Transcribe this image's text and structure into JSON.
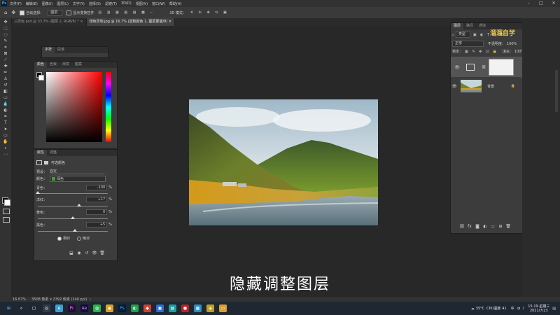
{
  "menubar": {
    "app_logo": "Ps",
    "items": [
      "文件(F)",
      "编辑(E)",
      "图像(I)",
      "图层(L)",
      "文字(Y)",
      "选择(S)",
      "滤镜(T)",
      "3D(D)",
      "视图(V)",
      "窗口(W)",
      "帮助(H)"
    ]
  },
  "options": {
    "auto_select_label": "自动选择：",
    "auto_select_value": "图层",
    "show_transform_label": "显示变换控件",
    "mode_3d_label": "3D 模式："
  },
  "tabs": [
    {
      "label": "三原色.psd @ 33.3% (图层 2, RGB/8) *",
      "close": "×"
    },
    {
      "label": "绿色草地.jpg @ 16.7% (选取颜色 1, 图层蒙版/8)",
      "close": "×"
    }
  ],
  "char_panel": {
    "tabs": [
      "字符",
      "段落"
    ]
  },
  "color_panel": {
    "tabs": [
      "颜色",
      "色板",
      "渐变",
      "图案"
    ]
  },
  "properties": {
    "tabs": [
      "属性",
      "调整"
    ],
    "title": "可选颜色",
    "preset_label": "预设：",
    "preset_value": "自定",
    "colors_label": "颜色：",
    "colors_value": "绿色",
    "rows": [
      {
        "label": "青色：",
        "value": "-100",
        "unit": "%",
        "slider": 0.0
      },
      {
        "label": "洋红：",
        "value": "+17",
        "unit": "%",
        "slider": 0.585
      },
      {
        "label": "黄色：",
        "value": "0",
        "unit": "%",
        "slider": 0.5
      },
      {
        "label": "黑色：",
        "value": "+5",
        "unit": "%",
        "slider": 0.525
      }
    ],
    "method_relative": "相对",
    "method_absolute": "绝对"
  },
  "layers_panel": {
    "tabs": [
      "图层",
      "路径",
      "通道"
    ],
    "kind_label": "类型",
    "blend_mode": "正常",
    "opacity_label": "不透明度：",
    "opacity_value": "100%",
    "lock_label": "锁定：",
    "fill_label": "填充：",
    "fill_value": "100%",
    "layers": [
      {
        "name": "",
        "type": "adjustment"
      },
      {
        "name": "背景",
        "type": "image"
      }
    ]
  },
  "subtitle": "隐藏调整图层",
  "status": {
    "zoom": "16.67%",
    "doc_info": "3508 像素 x 2392 像素 (240 ppi)"
  },
  "taskbar": {
    "weather": "35°C",
    "ime": "中",
    "time": "15:19 星期三",
    "date": "2021/7/23",
    "cpu_label": "CPU温度",
    "cpu_value": "41",
    "notification_count": "41"
  },
  "watermark": "溜溜自学"
}
